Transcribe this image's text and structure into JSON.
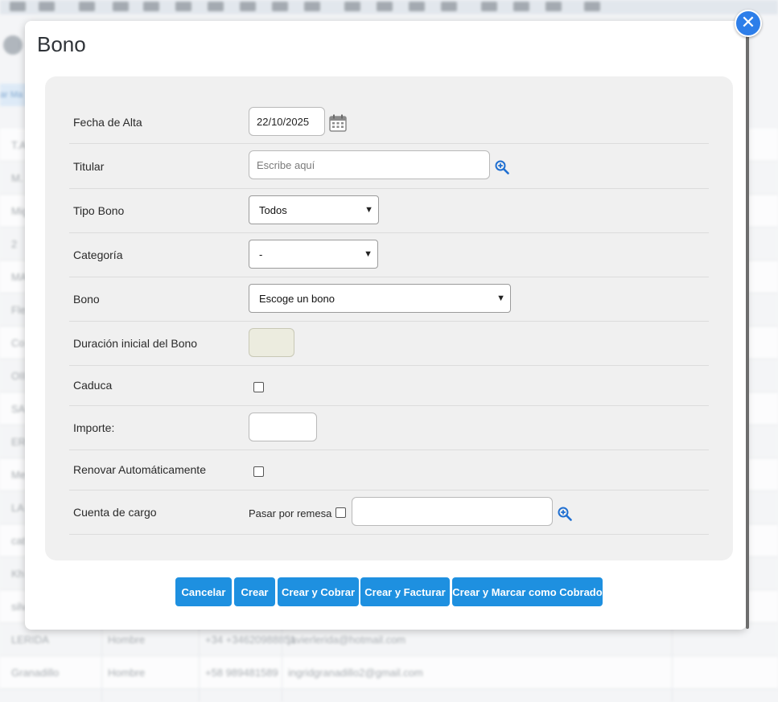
{
  "background": {
    "rows": [
      {
        "c1": "T.A",
        "c2": "",
        "c3": "",
        "c4": ""
      },
      {
        "c1": "M.",
        "c2": "",
        "c3": "",
        "c4": ""
      },
      {
        "c1": "Mig",
        "c2": "",
        "c3": "",
        "c4": ""
      },
      {
        "c1": "2",
        "c2": "",
        "c3": "",
        "c4": ""
      },
      {
        "c1": "MA",
        "c2": "",
        "c3": "",
        "c4": ""
      },
      {
        "c1": "Fle",
        "c2": "",
        "c3": "",
        "c4": ""
      },
      {
        "c1": "Co",
        "c2": "",
        "c3": "",
        "c4": ""
      },
      {
        "c1": "OII",
        "c2": "",
        "c3": "",
        "c4": ""
      },
      {
        "c1": "SA",
        "c2": "",
        "c3": "",
        "c4": ""
      },
      {
        "c1": "ER",
        "c2": "",
        "c3": "",
        "c4": ""
      },
      {
        "c1": "Me",
        "c2": "",
        "c3": "",
        "c4": ""
      },
      {
        "c1": "LA",
        "c2": "",
        "c3": "",
        "c4": ""
      },
      {
        "c1": "cat",
        "c2": "",
        "c3": "",
        "c4": ""
      },
      {
        "c1": "Kh",
        "c2": "",
        "c3": "",
        "c4": ""
      },
      {
        "c1": "silv",
        "c2": "",
        "c3": "",
        "c4": ""
      },
      {
        "c1": "LERIDA",
        "c2": "Hombre",
        "c3": "+34 +34620988851",
        "c4": "javierlerida@hotmail.com"
      },
      {
        "c1": "Granadillo",
        "c2": "Hombre",
        "c3": "+58 989481589",
        "c4": "ingridgranadillo2@gmail.com"
      }
    ],
    "link_fragment": "ar Ma"
  },
  "modal": {
    "title": "Bono",
    "close_symbol": "✕",
    "fields": {
      "fecha_alta": {
        "label": "Fecha de Alta",
        "value": "22/10/2025"
      },
      "titular": {
        "label": "Titular",
        "placeholder": "Escribe aquí"
      },
      "tipo_bono": {
        "label": "Tipo Bono",
        "value": "Todos"
      },
      "categoria": {
        "label": "Categoría",
        "value": "-"
      },
      "bono": {
        "label": "Bono",
        "value": "Escoge un bono"
      },
      "duracion": {
        "label": "Duración inicial del Bono",
        "value": ""
      },
      "caduca": {
        "label": "Caduca",
        "checked": false
      },
      "importe": {
        "label": "Importe:",
        "value": ""
      },
      "renovar": {
        "label": "Renovar Automáticamente",
        "checked": false
      },
      "cuenta": {
        "label": "Cuenta de cargo",
        "remesa_label": "Pasar por remesa",
        "remesa_checked": false,
        "value": ""
      }
    },
    "buttons": {
      "cancelar": "Cancelar",
      "crear": "Crear",
      "crear_cobrar": "Crear y Cobrar",
      "crear_facturar": "Crear y Facturar",
      "crear_marcar": "Crear y Marcar como Cobrado"
    },
    "colors": {
      "accent": "#1e90e0",
      "close": "#2d7ee9",
      "icon": "#1f6fd1"
    }
  }
}
